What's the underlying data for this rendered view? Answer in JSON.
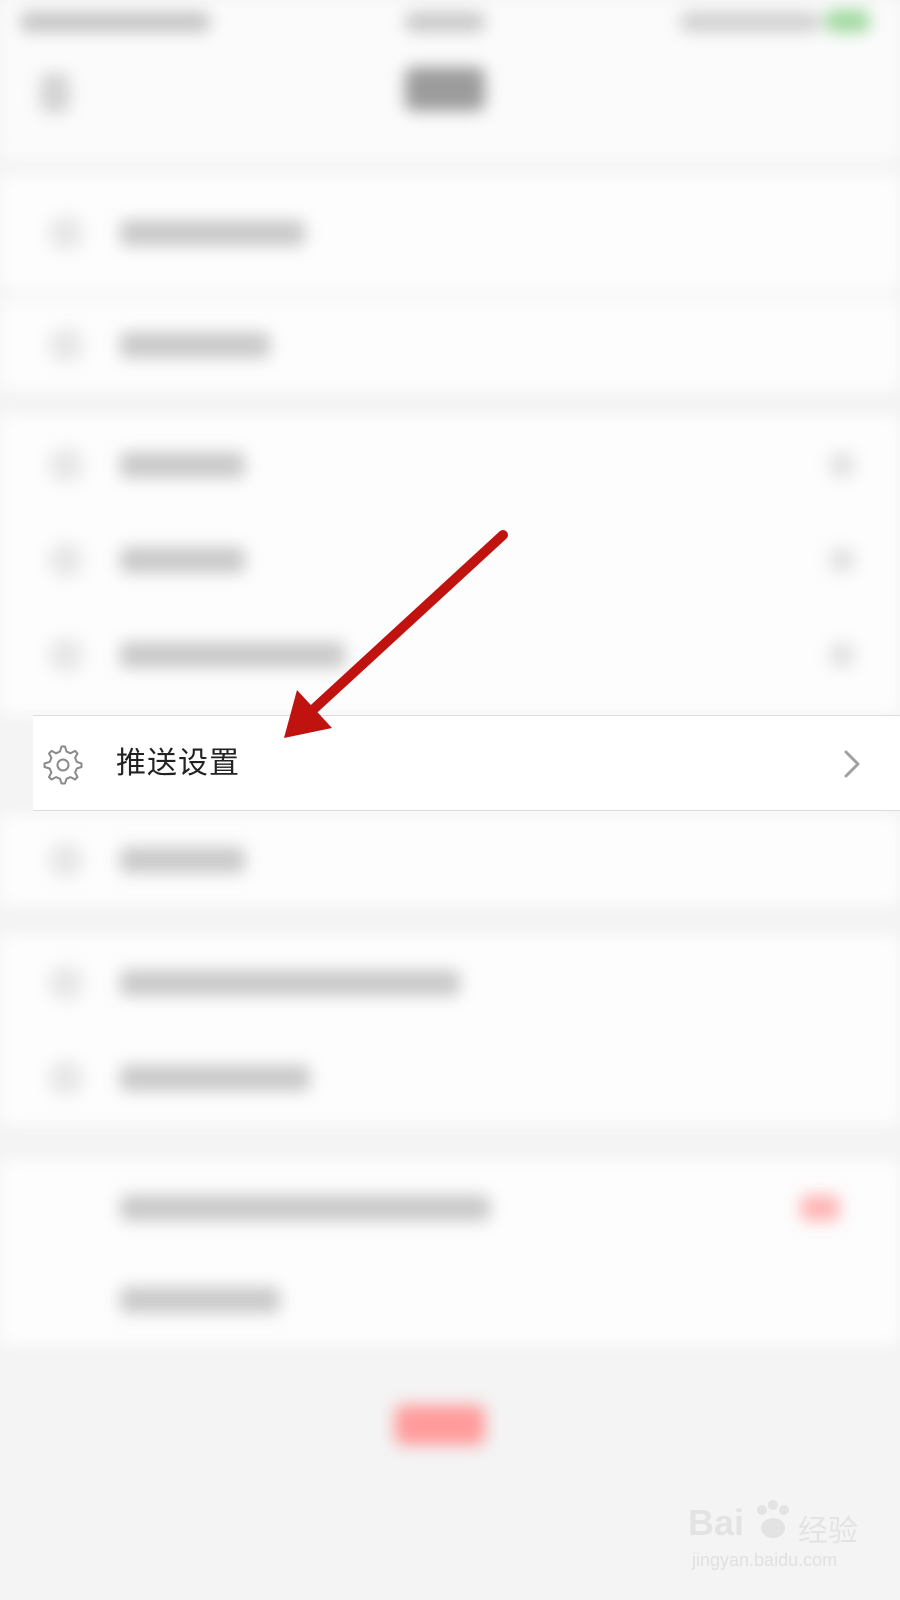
{
  "settings_list": {
    "push_settings": {
      "label": "推送设置",
      "icon": "gear-icon",
      "chevron_icon": "chevron-right-icon"
    }
  },
  "annotation": {
    "color": "#c0130f"
  },
  "watermark": {
    "brand": "Bai",
    "suffix": "经验",
    "url": "jingyan.baidu.com"
  }
}
